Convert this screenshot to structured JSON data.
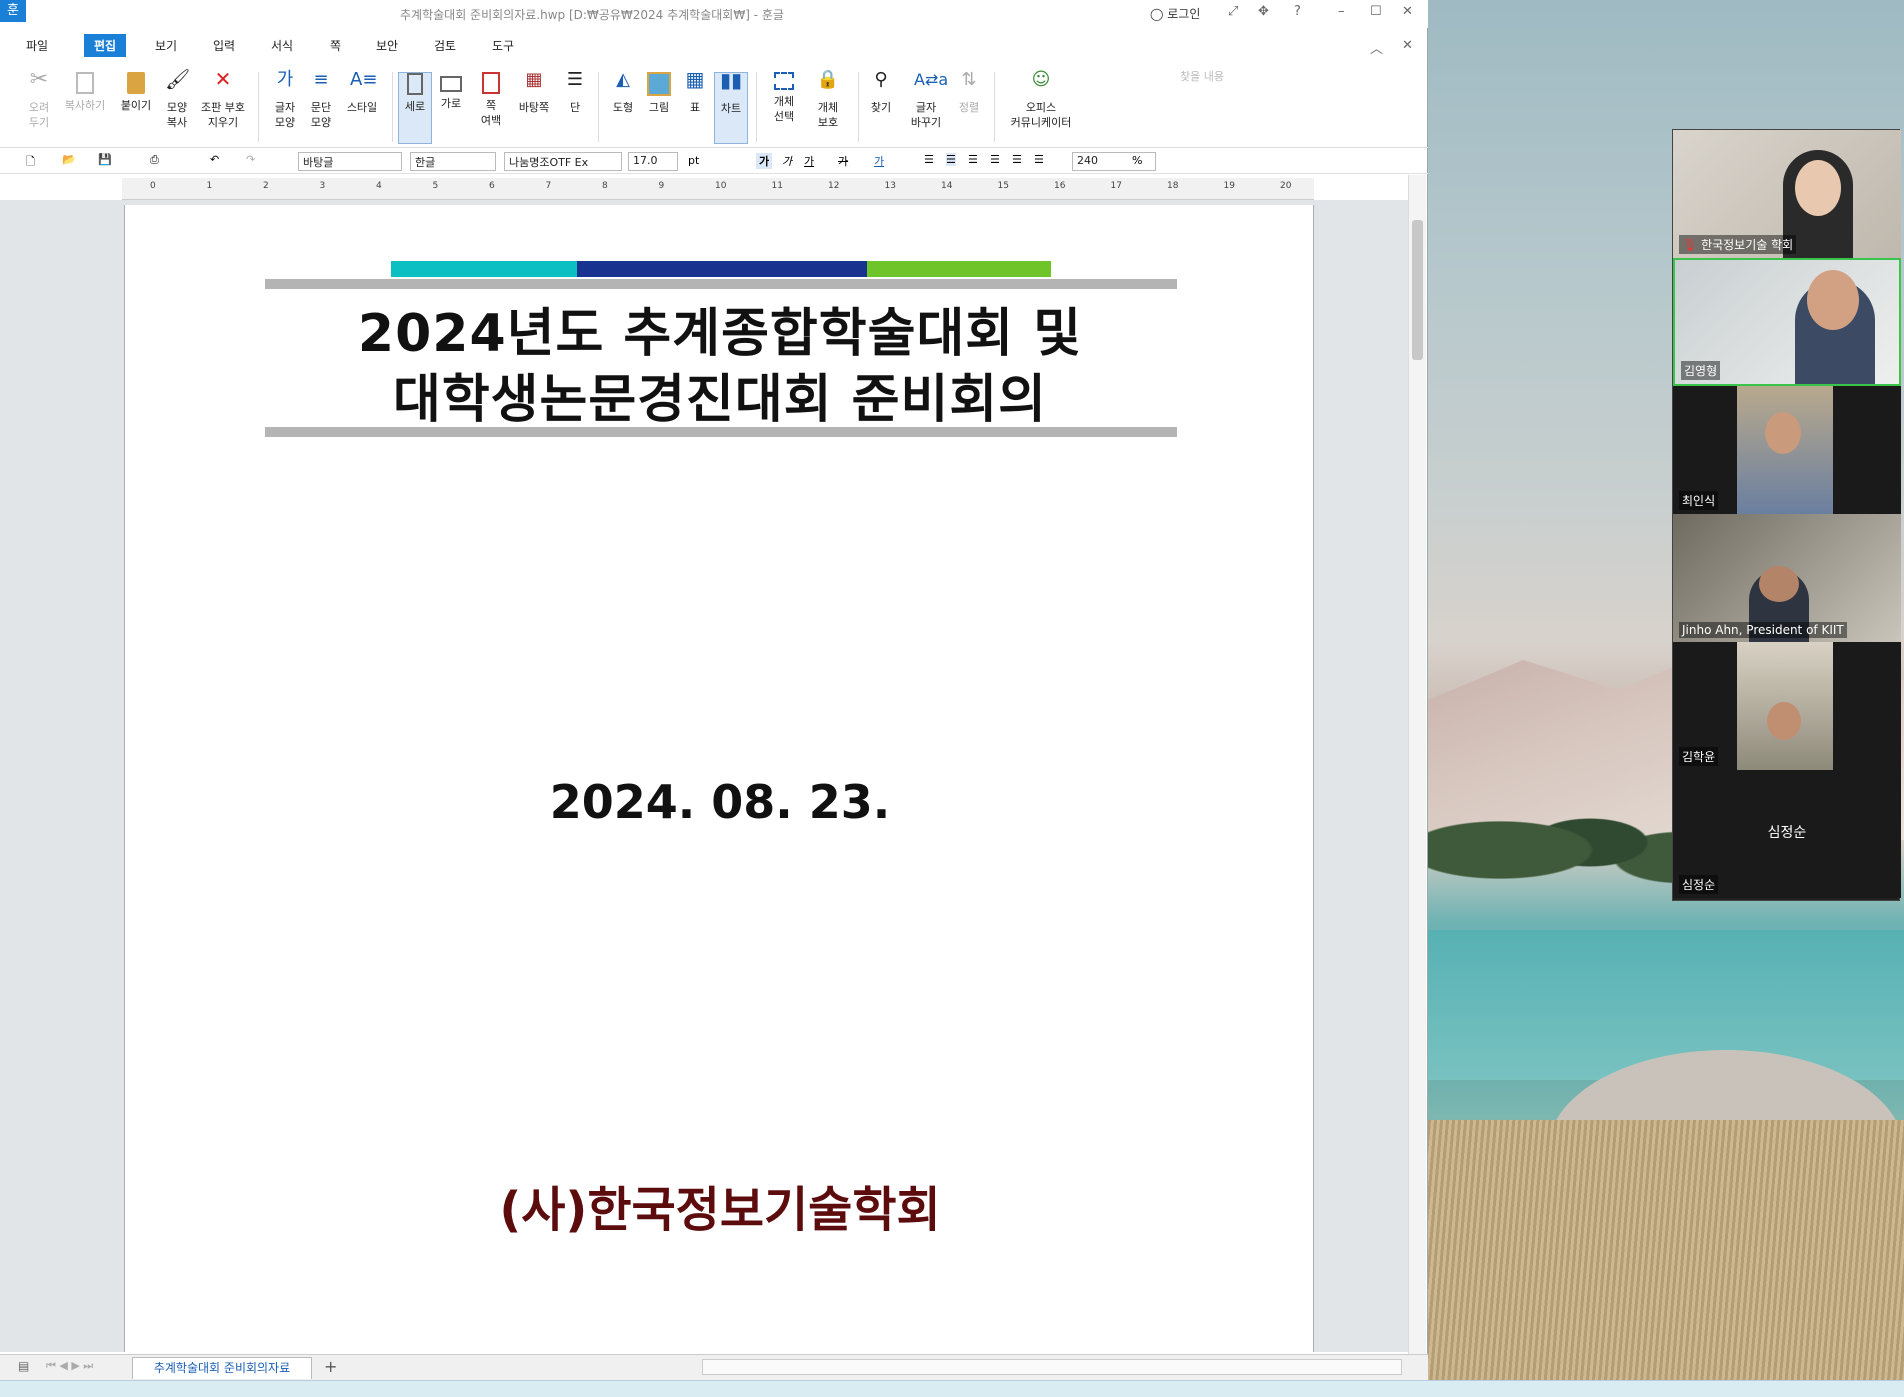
{
  "window": {
    "app_icon": "훈",
    "title": "추계학술대회 준비회의자료.hwp [D:₩공유₩2024 추계학술대회₩] - 훈글",
    "login": "로그인",
    "help": "?"
  },
  "menu": {
    "items": [
      "파일",
      "편집",
      "보기",
      "입력",
      "서식",
      "쪽",
      "보안",
      "검토",
      "도구"
    ],
    "active": "편집",
    "search_placeholder": "찾을 내용"
  },
  "ribbon": {
    "cut": "오려\n두기",
    "copy": "복사하기",
    "paste": "붙이기",
    "format_copy": "모양\n복사",
    "clear_format": "조판 부호\n지우기",
    "char_shape": "글자\n모양",
    "para_shape": "문단\n모양",
    "style": "스타일",
    "portrait": "세로",
    "landscape": "가로",
    "margins": "쪽\n여백",
    "background": "바탕쪽",
    "columns": "단",
    "shape": "도형",
    "picture": "그림",
    "table": "표",
    "chart": "차트",
    "object_select": "개체\n선택",
    "object_protect": "개체\n보호",
    "find": "찾기",
    "replace": "글자\n바꾸기",
    "sort": "정렬",
    "office_communicator": "오피스\n커뮤니케이터"
  },
  "format_bar": {
    "style": "바탕글",
    "language": "한글",
    "font": "나눔명조OTF Ex",
    "size": "17.0",
    "unit": "pt",
    "line_spacing": "240",
    "percent": "%"
  },
  "ruler": [
    "0",
    "1",
    "2",
    "3",
    "4",
    "5",
    "6",
    "7",
    "8",
    "9",
    "10",
    "11",
    "12",
    "13",
    "14",
    "15",
    "16",
    "17",
    "18",
    "19",
    "20"
  ],
  "document": {
    "title_line1": "2024년도 추계종합학술대회 및",
    "title_line2": "대학생논문경진대회 준비회의",
    "date": "2024. 08. 23.",
    "organization": "(사)한국정보기술학회",
    "accent_colors": [
      "#0bbfc3",
      "#17338f",
      "#6fc42a"
    ]
  },
  "tabs": {
    "doc_tab": "추계학술대회 준비회의자료",
    "add": "+"
  },
  "participants": [
    {
      "name": "한국정보기술 학회",
      "muted": true
    },
    {
      "name": "김영형",
      "active": true
    },
    {
      "name": "최인식"
    },
    {
      "name": "Jinho Ahn, President of KIIT"
    },
    {
      "name": "김학윤"
    },
    {
      "name": "심정순",
      "center_label": "심정순"
    }
  ]
}
